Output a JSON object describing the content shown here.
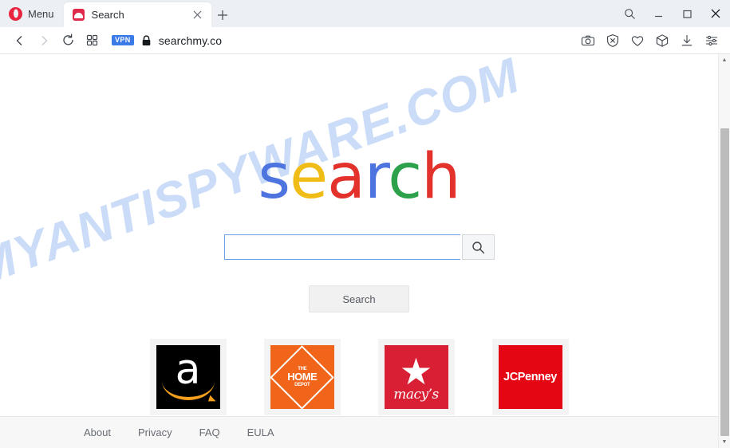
{
  "browser": {
    "menu_label": "Menu",
    "tab": {
      "title": "Search",
      "close_label": "×",
      "favicon": "search-site-favicon"
    },
    "new_tab_label": "+",
    "window_controls": {
      "search": "window-search-icon",
      "minimize": "minimize-icon",
      "maximize": "maximize-icon",
      "close": "close-icon"
    },
    "toolbar": {
      "back": "back-arrow-icon",
      "forward": "forward-arrow-icon",
      "reload": "reload-icon",
      "speeddial": "speed-dial-icon",
      "vpn_badge": "VPN",
      "lock": "padlock-icon",
      "url": "searchmy.co",
      "right_icons": [
        "snapshot-camera-icon",
        "ad-blocker-shield-icon",
        "favorites-heart-icon",
        "crypto-wallet-cube-icon",
        "downloads-icon",
        "easy-setup-sliders-icon"
      ]
    }
  },
  "page": {
    "watermark": "MYANTISPYWARE.COM",
    "logo": {
      "letters": [
        {
          "char": "s",
          "color": "#4e74e0"
        },
        {
          "char": "e",
          "color": "#f0bc18"
        },
        {
          "char": "a",
          "color": "#e2322b"
        },
        {
          "char": "r",
          "color": "#4e74e0"
        },
        {
          "char": "c",
          "color": "#2ea14c"
        },
        {
          "char": "h",
          "color": "#e2322b"
        }
      ]
    },
    "search": {
      "value": "",
      "placeholder": "",
      "go_icon": "magnifier-icon",
      "button_label": "Search"
    },
    "tiles": [
      {
        "name": "Amazon",
        "key": "amazon",
        "bg": "#000000",
        "accent": "#f4a01c"
      },
      {
        "name": "The Home Depot",
        "key": "homedepot",
        "bg": "#f06519",
        "line1": "THE",
        "line2": "HOME",
        "line3": "DEPOT"
      },
      {
        "name": "Macy's",
        "key": "macys",
        "bg": "#d81f33",
        "wordmark": "macy’s",
        "star": "★"
      },
      {
        "name": "JCPenney",
        "key": "jcpenney",
        "bg": "#e40613",
        "wordmark": "JCPenney"
      }
    ],
    "footer_links": [
      {
        "label": "About"
      },
      {
        "label": "Privacy"
      },
      {
        "label": "FAQ"
      },
      {
        "label": "EULA"
      }
    ]
  },
  "scrollbar": {
    "up": "▲",
    "down": "▼"
  }
}
